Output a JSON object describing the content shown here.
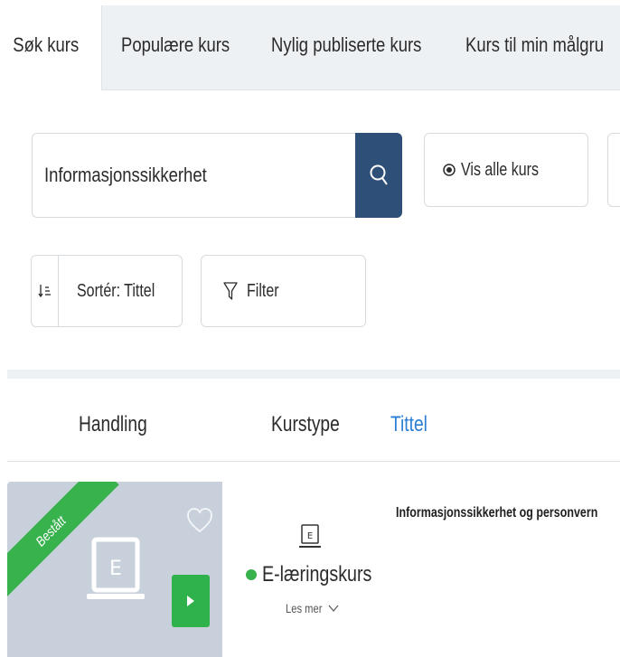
{
  "tabs": [
    {
      "label": "Søk kurs",
      "active": true
    },
    {
      "label": "Populære kurs",
      "active": false
    },
    {
      "label": "Nylig publiserte kurs",
      "active": false
    },
    {
      "label": "Kurs til min målgru",
      "active": false
    }
  ],
  "search": {
    "value": "Informasjonssikkerhet",
    "button_icon": "search-icon"
  },
  "toolbar": {
    "show_all_label": "Vis alle kurs",
    "sort_label": "Sortér: Tittel",
    "filter_label": "Filter"
  },
  "columns": {
    "action": "Handling",
    "course_type": "Kurstype",
    "title": "Tittel",
    "active": "Tittel"
  },
  "course": {
    "badge": "Bestått",
    "type_icon_letter": "E",
    "type": "E-læringskurs",
    "read_more": "Les mer",
    "title": "Informasjonssikkerhet og personvern",
    "status_color": "#37b24d"
  },
  "colors": {
    "primary": "#2e4f78",
    "link": "#2a7fd4",
    "success": "#37b24d"
  }
}
